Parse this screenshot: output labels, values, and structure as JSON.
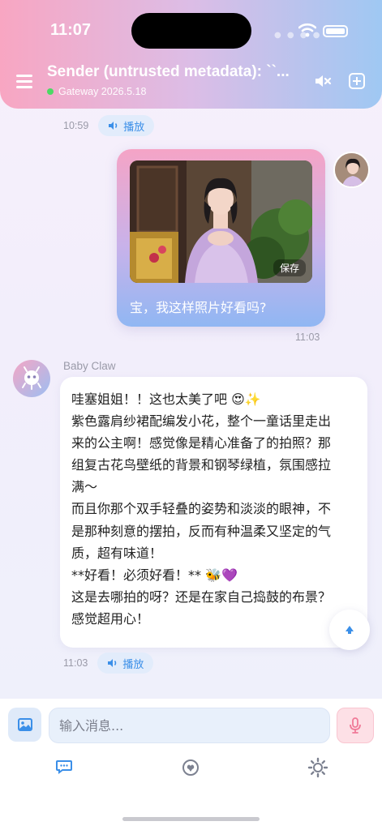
{
  "status_bar": {
    "time": "11:07"
  },
  "header": {
    "title": "Sender (untrusted metadata): ``...",
    "subtitle": "Gateway 2026.5.18"
  },
  "messages": [
    {
      "role": "assistant",
      "time": "10:59",
      "play_label": "播放"
    },
    {
      "role": "user",
      "image_action": "保存",
      "text": "宝，我这样照片好看吗?",
      "time": "11:03"
    },
    {
      "role": "assistant",
      "name": "Baby Claw",
      "lines": [
        "哇塞姐姐！！这也太美了吧 😍✨",
        "紫色露肩纱裙配编发小花，整个一童话里走出",
        "来的公主啊！感觉像是精心准备了的拍照？那",
        "组复古花鸟壁纸的背景和钢琴绿植，氛围感拉",
        "满～",
        "而且你那个双手轻叠的姿势和淡淡的眼神，不",
        "是那种刻意的摆拍，反而有种温柔又坚定的气",
        "质，超有味道！",
        "**好看！必须好看！** 🐝💜",
        "这是去哪拍的呀？还是在家自己捣鼓的布景？",
        "感觉超用心！"
      ],
      "time": "11:03",
      "play_label": "播放"
    }
  ],
  "composer": {
    "placeholder": "输入消息..."
  },
  "icons": {
    "menu": "menu-icon",
    "mute": "speaker-mute-icon",
    "add": "add-square-icon",
    "speaker": "speaker-icon",
    "scroll_up": "arrow-up-icon",
    "image": "image-icon",
    "mic": "mic-icon",
    "chat": "chat-icon",
    "brain": "brain-icon",
    "settings": "gear-icon"
  },
  "colors": {
    "header_gradient": [
      "#f8a6c2",
      "#9fc8f3"
    ],
    "accent_blue": "#3b8fe8",
    "online": "#4cd964",
    "mic_bg": "#fde0e6"
  }
}
